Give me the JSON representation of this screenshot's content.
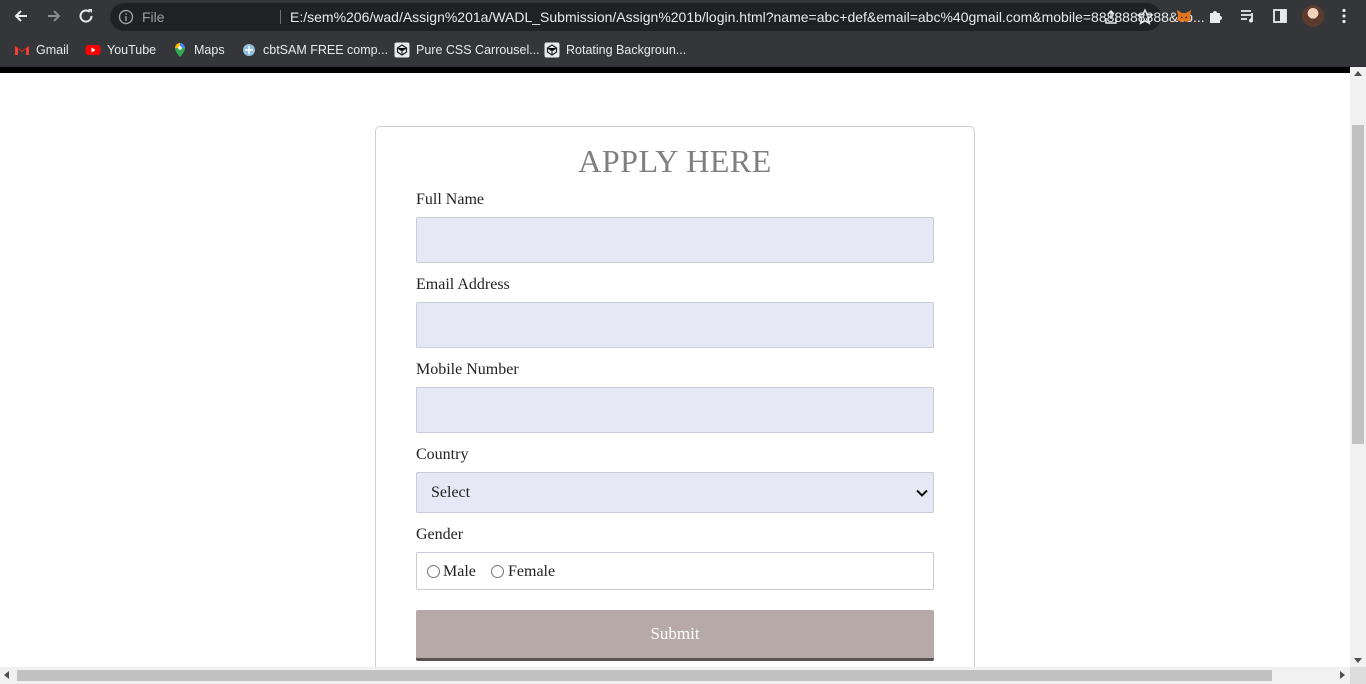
{
  "browser": {
    "file_label": "File",
    "url": "E:/sem%206/wad/Assign%201a/WADL_Submission/Assign%201b/login.html?name=abc+def&email=abc%40gmail.com&mobile=8888888888&co...",
    "bookmarks": [
      {
        "label": "Gmail",
        "icon": "gmail-icon"
      },
      {
        "label": "YouTube",
        "icon": "youtube-icon"
      },
      {
        "label": "Maps",
        "icon": "maps-icon"
      },
      {
        "label": "cbtSAM FREE comp...",
        "icon": "cbtsam-icon"
      },
      {
        "label": "Pure CSS Carrousel...",
        "icon": "codepen-icon"
      },
      {
        "label": "Rotating Backgroun...",
        "icon": "codepen-icon"
      }
    ]
  },
  "form": {
    "title": "APPLY HERE",
    "full_name_label": "Full Name",
    "full_name_value": "",
    "email_label": "Email Address",
    "email_value": "",
    "mobile_label": "Mobile Number",
    "mobile_value": "",
    "country_label": "Country",
    "country_selected": "Select",
    "gender_label": "Gender",
    "gender_options": [
      "Male",
      "Female"
    ],
    "submit_label": "Submit"
  },
  "colors": {
    "title": "#7f7f7f",
    "input_bg": "#e6e9f5",
    "submit_bg": "#b7a9a8",
    "submit_border": "#5b5152"
  }
}
